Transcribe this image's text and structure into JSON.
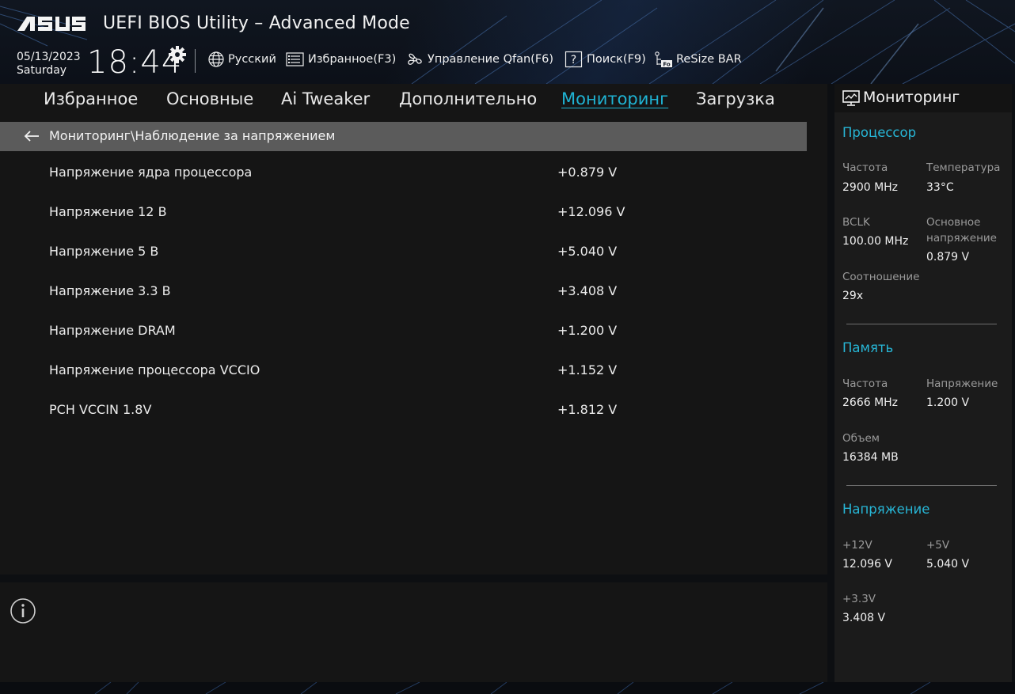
{
  "header": {
    "brand": "ASUS",
    "title": "UEFI BIOS Utility – Advanced Mode",
    "date": "05/13/2023",
    "day": "Saturday",
    "time": "18:44",
    "tools": [
      {
        "icon": "globe-icon",
        "label": "Русский"
      },
      {
        "icon": "favorites-icon",
        "label": "Избранное(F3)"
      },
      {
        "icon": "fan-icon",
        "label": "Управление Qfan(F6)"
      },
      {
        "icon": "search-icon",
        "label": "Поиск(F9)"
      },
      {
        "icon": "resize-bar-icon",
        "label": "ReSize BAR"
      }
    ]
  },
  "tabs": [
    {
      "label": "Избранное"
    },
    {
      "label": "Основные"
    },
    {
      "label": "Ai Tweaker"
    },
    {
      "label": "Дополнительно"
    },
    {
      "label": "Мониторинг",
      "active": true
    },
    {
      "label": "Загрузка"
    }
  ],
  "breadcrumb": "Мониторинг\\Наблюдение за напряжением",
  "voltages": [
    {
      "label": "Напряжение ядра процессора",
      "value": "+0.879 V"
    },
    {
      "label": "Напряжение 12 В",
      "value": "+12.096 V"
    },
    {
      "label": "Напряжение 5 В",
      "value": "+5.040 V"
    },
    {
      "label": "Напряжение 3.3 В",
      "value": "+3.408 V"
    },
    {
      "label": "Напряжение DRAM",
      "value": "+1.200 V"
    },
    {
      "label": "Напряжение процессора VCCIO",
      "value": "+1.152 V"
    },
    {
      "label": "PCH VCCIN 1.8V",
      "value": "+1.812 V"
    }
  ],
  "monitor": {
    "title": "Мониторинг",
    "cpu": {
      "title": "Процессор",
      "freq_label": "Частота",
      "freq_value": "2900 MHz",
      "temp_label": "Температура",
      "temp_value": "33°C",
      "bclk_label": "BCLK",
      "bclk_value": "100.00 MHz",
      "core_label_1": "Основное",
      "core_label_2": "напряжение",
      "core_value": "0.879 V",
      "ratio_label": "Соотношение",
      "ratio_value": "29x"
    },
    "memory": {
      "title": "Память",
      "freq_label": "Частота",
      "freq_value": "2666 MHz",
      "volt_label": "Напряжение",
      "volt_value": "1.200 V",
      "size_label": "Объем",
      "size_value": "16384 MB"
    },
    "voltage": {
      "title": "Напряжение",
      "v12_label": "+12V",
      "v12_value": "12.096 V",
      "v5_label": "+5V",
      "v5_value": "5.040 V",
      "v33_label": "+3.3V",
      "v33_value": "3.408 V"
    }
  },
  "colors": {
    "accent": "#27b6d6",
    "panel": "#151515",
    "breadcrumb_bg": "#5b5b5b"
  }
}
